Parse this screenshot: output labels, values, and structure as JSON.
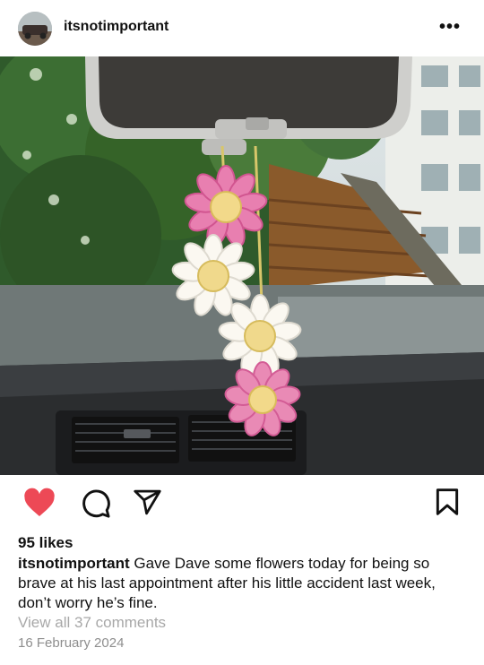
{
  "post": {
    "username": "itsnotimportant",
    "more_icon": "ellipsis-icon",
    "likes": "95 likes",
    "caption_user": "itsnotimportant",
    "caption_text": "Gave Dave some flowers today for being so brave at his last appointment after his little accident last week, don’t worry he’s fine.",
    "comments_link": "View all 37 comments",
    "date": "16 February 2024"
  },
  "actions": {
    "like_icon": "heart-filled-icon",
    "comment_icon": "comment-icon",
    "share_icon": "send-icon",
    "save_icon": "bookmark-icon"
  },
  "colors": {
    "like": "#ed4956",
    "muted": "#8e8e8e",
    "text": "#111111"
  }
}
